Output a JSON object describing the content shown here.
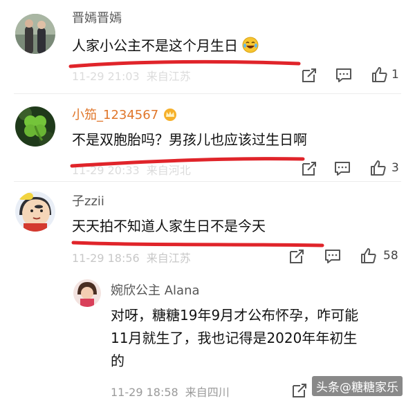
{
  "comments": [
    {
      "username": "晋嫣晋嫣",
      "text": "人家小公主不是这个月生日",
      "emoji": "laugh-cry-emoji",
      "date": "11-29 21:03",
      "location": "来自江苏",
      "likes": "1"
    },
    {
      "username": "小笳_1234567",
      "badge": "crown-badge-icon",
      "text": "不是双胞胎吗？男孩儿也应该过生日啊",
      "date": "11-29 20:33",
      "location": "来自河北",
      "likes": "3"
    },
    {
      "username": "子zzii",
      "text": "天天拍不知道人家生日不是今天",
      "date": "11-29 18:56",
      "location": "来自江苏",
      "likes": "58"
    }
  ],
  "reply": {
    "username": "婉欣公主 Alana",
    "text_lines": [
      "对呀，糖糖19年9月才公布怀孕，咋可能",
      "11月就生了，我也记得是2020年年初生",
      "的"
    ],
    "date": "11-29 18:58",
    "location": "来自四川"
  },
  "watermark": "头条@糖糖家乐",
  "colors": {
    "annotation_red": "#e0242a",
    "vip_name": "#e0762a",
    "meta_gray": "#9a9a9a"
  }
}
